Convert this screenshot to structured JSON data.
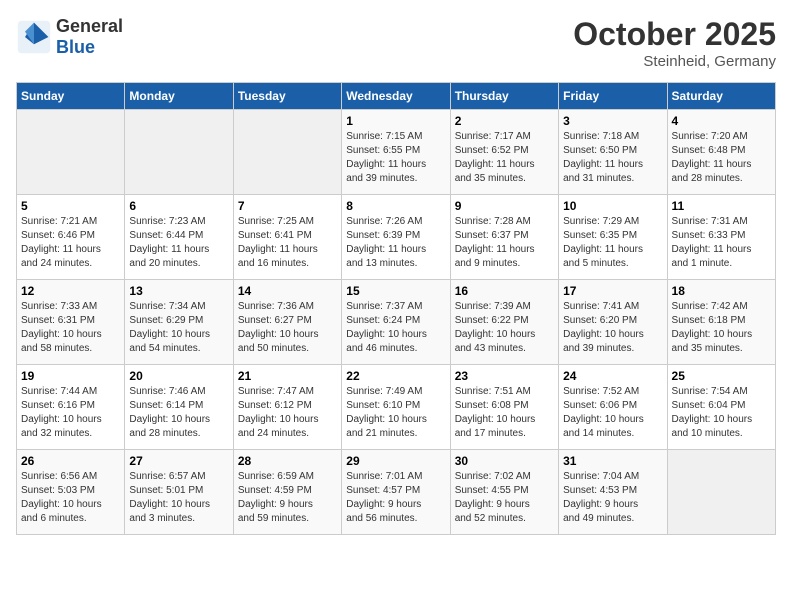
{
  "header": {
    "logo_line1": "General",
    "logo_line2": "Blue",
    "month": "October 2025",
    "location": "Steinheid, Germany"
  },
  "days_of_week": [
    "Sunday",
    "Monday",
    "Tuesday",
    "Wednesday",
    "Thursday",
    "Friday",
    "Saturday"
  ],
  "weeks": [
    [
      {
        "num": "",
        "info": ""
      },
      {
        "num": "",
        "info": ""
      },
      {
        "num": "",
        "info": ""
      },
      {
        "num": "1",
        "info": "Sunrise: 7:15 AM\nSunset: 6:55 PM\nDaylight: 11 hours\nand 39 minutes."
      },
      {
        "num": "2",
        "info": "Sunrise: 7:17 AM\nSunset: 6:52 PM\nDaylight: 11 hours\nand 35 minutes."
      },
      {
        "num": "3",
        "info": "Sunrise: 7:18 AM\nSunset: 6:50 PM\nDaylight: 11 hours\nand 31 minutes."
      },
      {
        "num": "4",
        "info": "Sunrise: 7:20 AM\nSunset: 6:48 PM\nDaylight: 11 hours\nand 28 minutes."
      }
    ],
    [
      {
        "num": "5",
        "info": "Sunrise: 7:21 AM\nSunset: 6:46 PM\nDaylight: 11 hours\nand 24 minutes."
      },
      {
        "num": "6",
        "info": "Sunrise: 7:23 AM\nSunset: 6:44 PM\nDaylight: 11 hours\nand 20 minutes."
      },
      {
        "num": "7",
        "info": "Sunrise: 7:25 AM\nSunset: 6:41 PM\nDaylight: 11 hours\nand 16 minutes."
      },
      {
        "num": "8",
        "info": "Sunrise: 7:26 AM\nSunset: 6:39 PM\nDaylight: 11 hours\nand 13 minutes."
      },
      {
        "num": "9",
        "info": "Sunrise: 7:28 AM\nSunset: 6:37 PM\nDaylight: 11 hours\nand 9 minutes."
      },
      {
        "num": "10",
        "info": "Sunrise: 7:29 AM\nSunset: 6:35 PM\nDaylight: 11 hours\nand 5 minutes."
      },
      {
        "num": "11",
        "info": "Sunrise: 7:31 AM\nSunset: 6:33 PM\nDaylight: 11 hours\nand 1 minute."
      }
    ],
    [
      {
        "num": "12",
        "info": "Sunrise: 7:33 AM\nSunset: 6:31 PM\nDaylight: 10 hours\nand 58 minutes."
      },
      {
        "num": "13",
        "info": "Sunrise: 7:34 AM\nSunset: 6:29 PM\nDaylight: 10 hours\nand 54 minutes."
      },
      {
        "num": "14",
        "info": "Sunrise: 7:36 AM\nSunset: 6:27 PM\nDaylight: 10 hours\nand 50 minutes."
      },
      {
        "num": "15",
        "info": "Sunrise: 7:37 AM\nSunset: 6:24 PM\nDaylight: 10 hours\nand 46 minutes."
      },
      {
        "num": "16",
        "info": "Sunrise: 7:39 AM\nSunset: 6:22 PM\nDaylight: 10 hours\nand 43 minutes."
      },
      {
        "num": "17",
        "info": "Sunrise: 7:41 AM\nSunset: 6:20 PM\nDaylight: 10 hours\nand 39 minutes."
      },
      {
        "num": "18",
        "info": "Sunrise: 7:42 AM\nSunset: 6:18 PM\nDaylight: 10 hours\nand 35 minutes."
      }
    ],
    [
      {
        "num": "19",
        "info": "Sunrise: 7:44 AM\nSunset: 6:16 PM\nDaylight: 10 hours\nand 32 minutes."
      },
      {
        "num": "20",
        "info": "Sunrise: 7:46 AM\nSunset: 6:14 PM\nDaylight: 10 hours\nand 28 minutes."
      },
      {
        "num": "21",
        "info": "Sunrise: 7:47 AM\nSunset: 6:12 PM\nDaylight: 10 hours\nand 24 minutes."
      },
      {
        "num": "22",
        "info": "Sunrise: 7:49 AM\nSunset: 6:10 PM\nDaylight: 10 hours\nand 21 minutes."
      },
      {
        "num": "23",
        "info": "Sunrise: 7:51 AM\nSunset: 6:08 PM\nDaylight: 10 hours\nand 17 minutes."
      },
      {
        "num": "24",
        "info": "Sunrise: 7:52 AM\nSunset: 6:06 PM\nDaylight: 10 hours\nand 14 minutes."
      },
      {
        "num": "25",
        "info": "Sunrise: 7:54 AM\nSunset: 6:04 PM\nDaylight: 10 hours\nand 10 minutes."
      }
    ],
    [
      {
        "num": "26",
        "info": "Sunrise: 6:56 AM\nSunset: 5:03 PM\nDaylight: 10 hours\nand 6 minutes."
      },
      {
        "num": "27",
        "info": "Sunrise: 6:57 AM\nSunset: 5:01 PM\nDaylight: 10 hours\nand 3 minutes."
      },
      {
        "num": "28",
        "info": "Sunrise: 6:59 AM\nSunset: 4:59 PM\nDaylight: 9 hours\nand 59 minutes."
      },
      {
        "num": "29",
        "info": "Sunrise: 7:01 AM\nSunset: 4:57 PM\nDaylight: 9 hours\nand 56 minutes."
      },
      {
        "num": "30",
        "info": "Sunrise: 7:02 AM\nSunset: 4:55 PM\nDaylight: 9 hours\nand 52 minutes."
      },
      {
        "num": "31",
        "info": "Sunrise: 7:04 AM\nSunset: 4:53 PM\nDaylight: 9 hours\nand 49 minutes."
      },
      {
        "num": "",
        "info": ""
      }
    ]
  ]
}
